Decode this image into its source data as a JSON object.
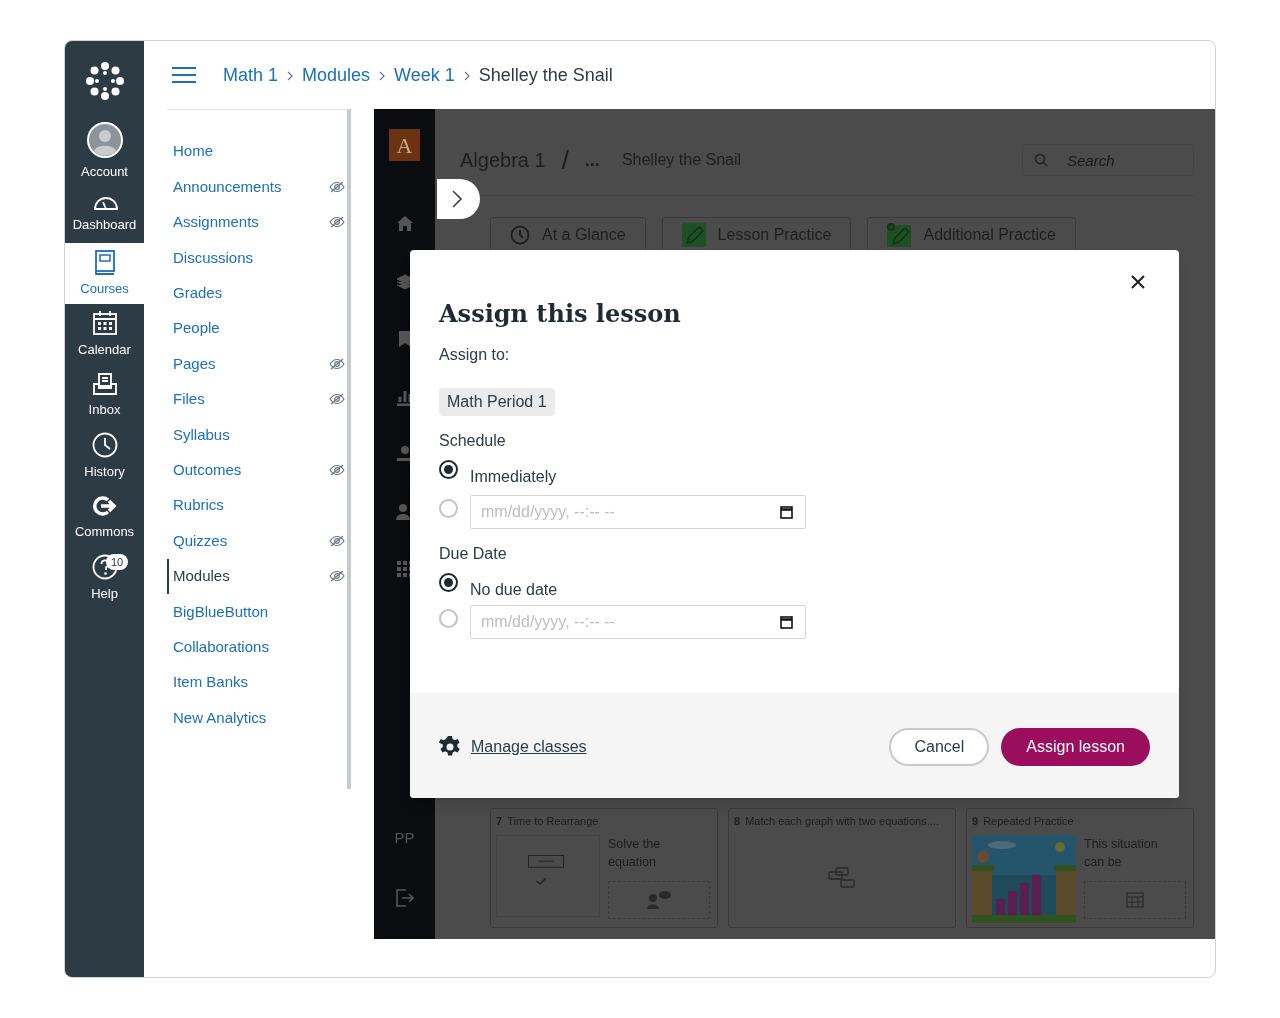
{
  "global_nav": [
    {
      "kind": "logo"
    },
    {
      "kind": "account",
      "label": "Account",
      "selected": false
    },
    {
      "kind": "dashboard",
      "label": "Dashboard",
      "selected": false
    },
    {
      "kind": "courses",
      "label": "Courses",
      "selected": true
    },
    {
      "kind": "calendar",
      "label": "Calendar",
      "selected": false
    },
    {
      "kind": "inbox",
      "label": "Inbox",
      "selected": false
    },
    {
      "kind": "history",
      "label": "History",
      "selected": false
    },
    {
      "kind": "commons",
      "label": "Commons",
      "selected": false
    },
    {
      "kind": "help",
      "label": "Help",
      "badge": "10",
      "selected": false
    }
  ],
  "breadcrumbs": [
    {
      "label": "Math 1",
      "current": false
    },
    {
      "label": "Modules",
      "current": false
    },
    {
      "label": "Week 1",
      "current": false
    },
    {
      "label": "Shelley the Snail",
      "current": true
    }
  ],
  "course_nav": [
    {
      "label": "Home",
      "selected": false,
      "hidden": false
    },
    {
      "label": "Announcements",
      "selected": false,
      "hidden": true
    },
    {
      "label": "Assignments",
      "selected": false,
      "hidden": true
    },
    {
      "label": "Discussions",
      "selected": false,
      "hidden": false
    },
    {
      "label": "Grades",
      "selected": false,
      "hidden": false
    },
    {
      "label": "People",
      "selected": false,
      "hidden": false
    },
    {
      "label": "Pages",
      "selected": false,
      "hidden": true
    },
    {
      "label": "Files",
      "selected": false,
      "hidden": true
    },
    {
      "label": "Syllabus",
      "selected": false,
      "hidden": false
    },
    {
      "label": "Outcomes",
      "selected": false,
      "hidden": true
    },
    {
      "label": "Rubrics",
      "selected": false,
      "hidden": false
    },
    {
      "label": "Quizzes",
      "selected": false,
      "hidden": true
    },
    {
      "label": "Modules",
      "selected": true,
      "hidden": true
    },
    {
      "label": "BigBlueButton",
      "selected": false,
      "hidden": false
    },
    {
      "label": "Collaborations",
      "selected": false,
      "hidden": false
    },
    {
      "label": "Item Banks",
      "selected": false,
      "hidden": false
    },
    {
      "label": "New Analytics",
      "selected": false,
      "hidden": false
    }
  ],
  "app": {
    "logo": "A",
    "course": "Algebra 1",
    "separator": "/",
    "ellipsis": "...",
    "title": "Shelley the Snail",
    "search": {
      "placeholder": "Search"
    },
    "initials": "PP",
    "tabs": [
      {
        "kind": "clock",
        "label": "At a Glance"
      },
      {
        "kind": "practice",
        "label": "Lesson Practice"
      },
      {
        "kind": "additional",
        "label": "Additional Practice"
      }
    ],
    "cards": [
      {
        "kind": "equation",
        "number": "7",
        "title": "Time to Rearrange",
        "text": "Solve the equation"
      },
      {
        "kind": "blocks",
        "number": "8",
        "title": "Match each graph with two equations...."
      },
      {
        "kind": "game",
        "number": "9",
        "title": "Repeated Practice",
        "text": "This situation can be"
      }
    ]
  },
  "modal": {
    "title": "Assign this lesson",
    "assign_to": "Assign to:",
    "class_chip": "Math Period 1",
    "schedule_label": "Schedule",
    "schedule_options": [
      {
        "kind": "text",
        "label": "Immediately",
        "selected": true
      },
      {
        "kind": "date",
        "placeholder": "mm/dd/yyyy, --:-- --",
        "selected": false
      }
    ],
    "due_label": "Due Date",
    "due_options": [
      {
        "kind": "text",
        "label": "No due date",
        "selected": true
      },
      {
        "kind": "date",
        "placeholder": "mm/dd/yyyy, --:-- --",
        "selected": false
      }
    ],
    "manage_link": "Manage classes",
    "cancel": "Cancel",
    "assign": "Assign lesson"
  }
}
